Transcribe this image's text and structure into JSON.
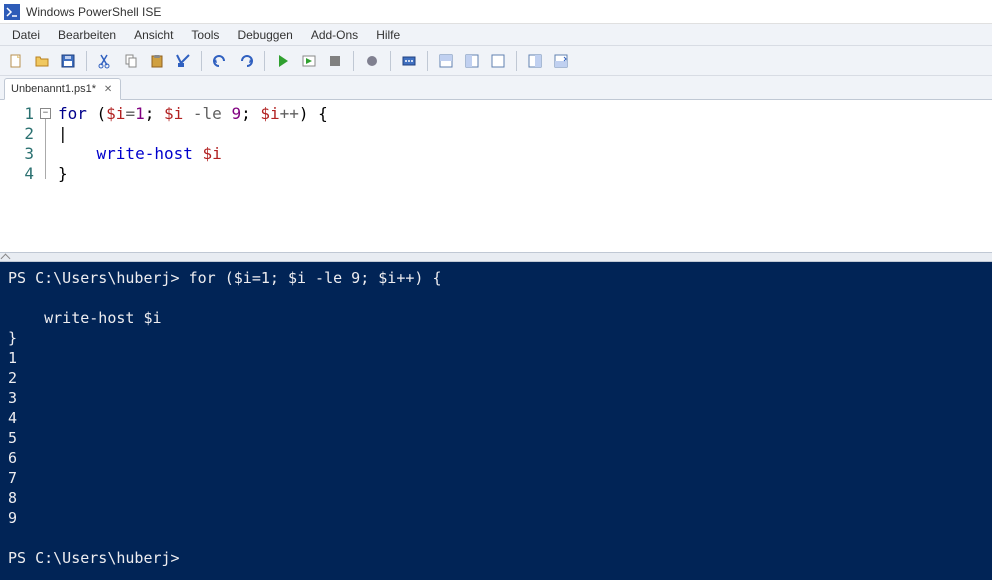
{
  "window": {
    "title": "Windows PowerShell ISE"
  },
  "menu": {
    "items": [
      "Datei",
      "Bearbeiten",
      "Ansicht",
      "Tools",
      "Debuggen",
      "Add-Ons",
      "Hilfe"
    ]
  },
  "toolbar": {
    "groups": [
      [
        "new-file",
        "open-file",
        "save-file"
      ],
      [
        "cut",
        "copy",
        "paste",
        "clear"
      ],
      [
        "undo",
        "redo"
      ],
      [
        "run",
        "run-selection",
        "stop"
      ],
      [
        "breakpoint"
      ],
      [
        "new-remote-tab"
      ],
      [
        "layout-1",
        "layout-2",
        "layout-3"
      ],
      [
        "show-command",
        "show-pane"
      ]
    ]
  },
  "tabs": {
    "active": {
      "label": "Unbenannt1.ps1*"
    }
  },
  "editor": {
    "line_numbers": [
      "1",
      "2",
      "3",
      "4"
    ],
    "code_lines": [
      {
        "tokens": [
          [
            "kw",
            "for"
          ],
          [
            "plain",
            " ("
          ],
          [
            "var",
            "$i"
          ],
          [
            "op",
            "="
          ],
          [
            "num",
            "1"
          ],
          [
            "plain",
            "; "
          ],
          [
            "var",
            "$i"
          ],
          [
            "plain",
            " "
          ],
          [
            "op",
            "-le"
          ],
          [
            "plain",
            " "
          ],
          [
            "num",
            "9"
          ],
          [
            "plain",
            "; "
          ],
          [
            "var",
            "$i"
          ],
          [
            "op",
            "++"
          ],
          [
            "plain",
            ") {"
          ]
        ]
      },
      {
        "tokens": [
          [
            "plain",
            "|"
          ]
        ]
      },
      {
        "tokens": [
          [
            "plain",
            "    "
          ],
          [
            "cmd",
            "write-host"
          ],
          [
            "plain",
            " "
          ],
          [
            "var",
            "$i"
          ]
        ]
      },
      {
        "tokens": [
          [
            "plain",
            "}"
          ]
        ]
      }
    ]
  },
  "console": {
    "prompt1": "PS C:\\Users\\huberj> ",
    "command": "for ($i=1; $i -le 9; $i++) {\n\n    write-host $i\n}",
    "output": [
      "1",
      "2",
      "3",
      "4",
      "5",
      "6",
      "7",
      "8",
      "9"
    ],
    "prompt2": "PS C:\\Users\\huberj>"
  },
  "icons": {
    "new-file": "new-file-icon",
    "open-file": "open-folder-icon",
    "save-file": "save-icon",
    "cut": "cut-icon",
    "copy": "copy-icon",
    "paste": "paste-icon",
    "clear": "clear-icon",
    "undo": "undo-icon",
    "redo": "redo-icon",
    "run": "play-icon",
    "run-selection": "run-selection-icon",
    "stop": "stop-icon",
    "breakpoint": "breakpoint-icon",
    "new-remote-tab": "remote-icon",
    "layout-1": "layout-1-icon",
    "layout-2": "layout-2-icon",
    "layout-3": "layout-3-icon",
    "show-command": "command-addon-icon",
    "show-pane": "show-pane-icon"
  }
}
